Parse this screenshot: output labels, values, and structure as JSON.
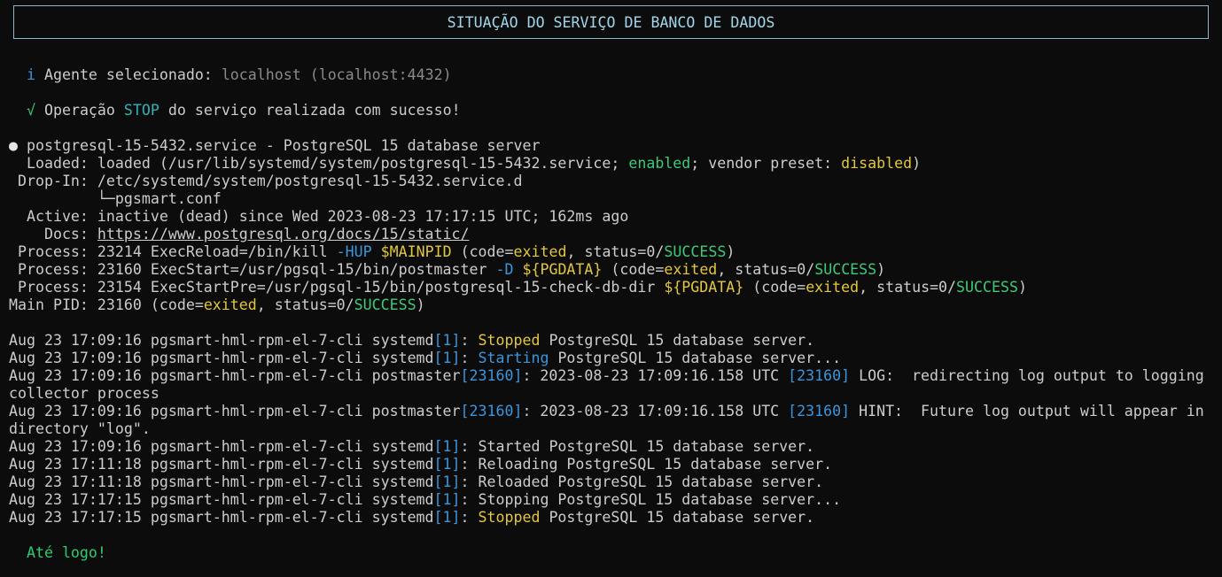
{
  "header": {
    "title": "SITUAÇÃO DO SERVIÇO DE BANCO DE DADOS"
  },
  "agent": {
    "icon": "i",
    "label": "Agente selecionado:",
    "value": "localhost (localhost:4432)"
  },
  "operation": {
    "icon": "√",
    "prefix": "Operação",
    "action": "STOP",
    "suffix": "do serviço realizada com sucesso!"
  },
  "service": {
    "bullet": "●",
    "title": "postgresql-15-5432.service - PostgreSQL 15 database server",
    "loaded_label": "  Loaded:",
    "loaded_a": "loaded (/usr/lib/systemd/system/postgresql-15-5432.service;",
    "loaded_enabled": "enabled",
    "loaded_b": "; vendor preset:",
    "loaded_disabled": "disabled",
    "loaded_c": ")",
    "dropin_label": " Drop-In:",
    "dropin_value": "/etc/systemd/system/postgresql-15-5432.service.d",
    "dropin_file": "          └─pgsmart.conf",
    "active_label": "  Active:",
    "active_value": "inactive (dead) since Wed 2023-08-23 17:17:15 UTC; 162ms ago",
    "docs_label": "    Docs:",
    "docs_value": "https://www.postgresql.org/docs/15/static/",
    "process1_label": " Process:",
    "process1_a": "23214 ExecReload=/bin/kill",
    "process1_flag": "-HUP",
    "process1_var": "$MAINPID",
    "process1_b": "(code=",
    "process1_exited": "exited",
    "process1_c": ", status=0/",
    "process1_success": "SUCCESS",
    "process1_d": ")",
    "process2_label": " Process:",
    "process2_a": "23160 ExecStart=/usr/pgsql-15/bin/postmaster",
    "process2_flag": "-D",
    "process2_var": "${PGDATA}",
    "process2_b": "(code=",
    "process2_exited": "exited",
    "process2_c": ", status=0/",
    "process2_success": "SUCCESS",
    "process2_d": ")",
    "process3_label": " Process:",
    "process3_a": "23154 ExecStartPre=/usr/pgsql-15/bin/postgresql-15-check-db-dir",
    "process3_var": "${PGDATA}",
    "process3_b": "(code=",
    "process3_exited": "exited",
    "process3_c": ", status=0/",
    "process3_success": "SUCCESS",
    "process3_d": ")",
    "mainpid_label": "Main PID:",
    "mainpid_a": "23160 (code=",
    "mainpid_exited": "exited",
    "mainpid_b": ", status=0/",
    "mainpid_success": "SUCCESS",
    "mainpid_c": ")"
  },
  "logs": [
    {
      "prefix": "Aug 23 17:09:16 pgsmart-hml-rpm-el-7-cli systemd",
      "pid": "[1]",
      "sep": ": ",
      "keyword": "Stopped",
      "rest": " PostgreSQL 15 database server."
    },
    {
      "prefix": "Aug 23 17:09:16 pgsmart-hml-rpm-el-7-cli systemd",
      "pid": "[1]",
      "sep": ": ",
      "keyword": "Starting",
      "rest": " PostgreSQL 15 database server..."
    },
    {
      "prefix": "Aug 23 17:09:16 pgsmart-hml-rpm-el-7-cli postmaster",
      "pid": "[23160]",
      "sep": ": 2023-08-23 17:09:16.158 UTC ",
      "pid2": "[23160]",
      "rest": " LOG:  redirecting log output to logging",
      "cont": "collector process"
    },
    {
      "prefix": "Aug 23 17:09:16 pgsmart-hml-rpm-el-7-cli postmaster",
      "pid": "[23160]",
      "sep": ": 2023-08-23 17:09:16.158 UTC ",
      "pid2": "[23160]",
      "rest": " HINT:  Future log output will appear in",
      "cont": "directory \"log\"."
    },
    {
      "prefix": "Aug 23 17:09:16 pgsmart-hml-rpm-el-7-cli systemd",
      "pid": "[1]",
      "sep": ": ",
      "rest": "Started PostgreSQL 15 database server."
    },
    {
      "prefix": "Aug 23 17:11:18 pgsmart-hml-rpm-el-7-cli systemd",
      "pid": "[1]",
      "sep": ": ",
      "rest": "Reloading PostgreSQL 15 database server."
    },
    {
      "prefix": "Aug 23 17:11:18 pgsmart-hml-rpm-el-7-cli systemd",
      "pid": "[1]",
      "sep": ": ",
      "rest": "Reloaded PostgreSQL 15 database server."
    },
    {
      "prefix": "Aug 23 17:17:15 pgsmart-hml-rpm-el-7-cli systemd",
      "pid": "[1]",
      "sep": ": ",
      "rest": "Stopping PostgreSQL 15 database server..."
    },
    {
      "prefix": "Aug 23 17:17:15 pgsmart-hml-rpm-el-7-cli systemd",
      "pid": "[1]",
      "sep": ": ",
      "keyword": "Stopped",
      "rest": " PostgreSQL 15 database server."
    }
  ],
  "farewell": "Até logo!",
  "colors": {
    "background": "#0c0c0c",
    "text": "#cccccc",
    "header_border": "#8fb8c8",
    "cyan": "#3a96dd",
    "green": "#3fc87a",
    "yellow": "#e3c73d",
    "gray": "#8a8a8a"
  }
}
